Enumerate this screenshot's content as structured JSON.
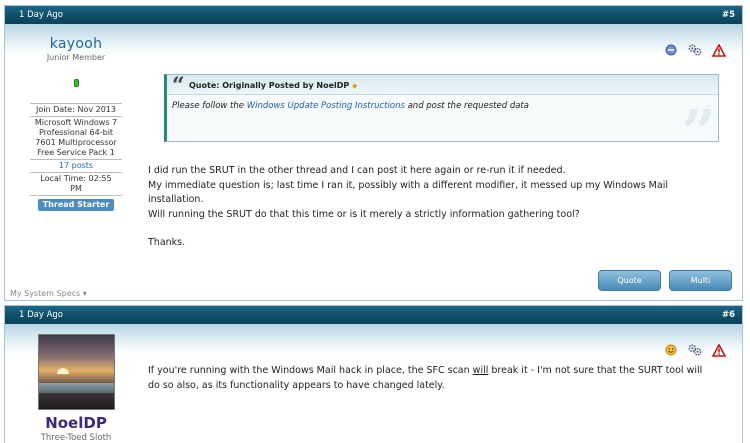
{
  "post1": {
    "date": "1 Day Ago",
    "number": "#5",
    "username": "kayooh",
    "user_title": "Junior Member",
    "join_date": "Join Date: Nov 2013",
    "os_lines": [
      "Microsoft Windows 7",
      "Professional 64-bit",
      "7601 Multiprocessor",
      "Free Service Pack 1"
    ],
    "posts": "17 posts",
    "local_time_label": "Local Time: 02:55",
    "local_time_ampm": "PM",
    "badge": "Thread Starter",
    "system_specs": "My System Specs",
    "quote": {
      "header": "Quote: Originally Posted by NoelDP",
      "body_before": "Please follow the ",
      "link": "Windows Update Posting Instructions",
      "body_after": " and post the requested data"
    },
    "message_lines": [
      "I did run the SRUT in the other thread and I can post it here again or re-run it if needed.",
      "My immediate question is; last time I ran it, possibly with a different modifier, it messed up my Windows Mail",
      "installation.",
      "Will running the SRUT do that this time or is it merely a strictly information gathering tool?",
      "",
      "Thanks."
    ],
    "quote_button": "Quote",
    "multi_button": "Multi"
  },
  "post2": {
    "date": "1 Day Ago",
    "number": "#6",
    "username": "NoelDP",
    "user_title": "Three-Toed Sloth",
    "message_part1": "If you're running with the Windows Mail hack in place, the SFC scan ",
    "message_underlined": "will",
    "message_part2": " break it - I'm not sure that the SURT tool will",
    "message_line2": "do so also, as its functionality appears to have changed lately."
  },
  "icons": {
    "post1": [
      "neutral-face-icon",
      "share-gears-icon",
      "report-warning-icon"
    ],
    "post2": [
      "smiley-face-icon",
      "share-gears-icon",
      "report-warning-icon"
    ]
  },
  "colors": {
    "header_bar": "#0f4e68",
    "username_link": "#2266a8",
    "badge": "#4c8cbf",
    "quote_accent": "#2a8878"
  }
}
